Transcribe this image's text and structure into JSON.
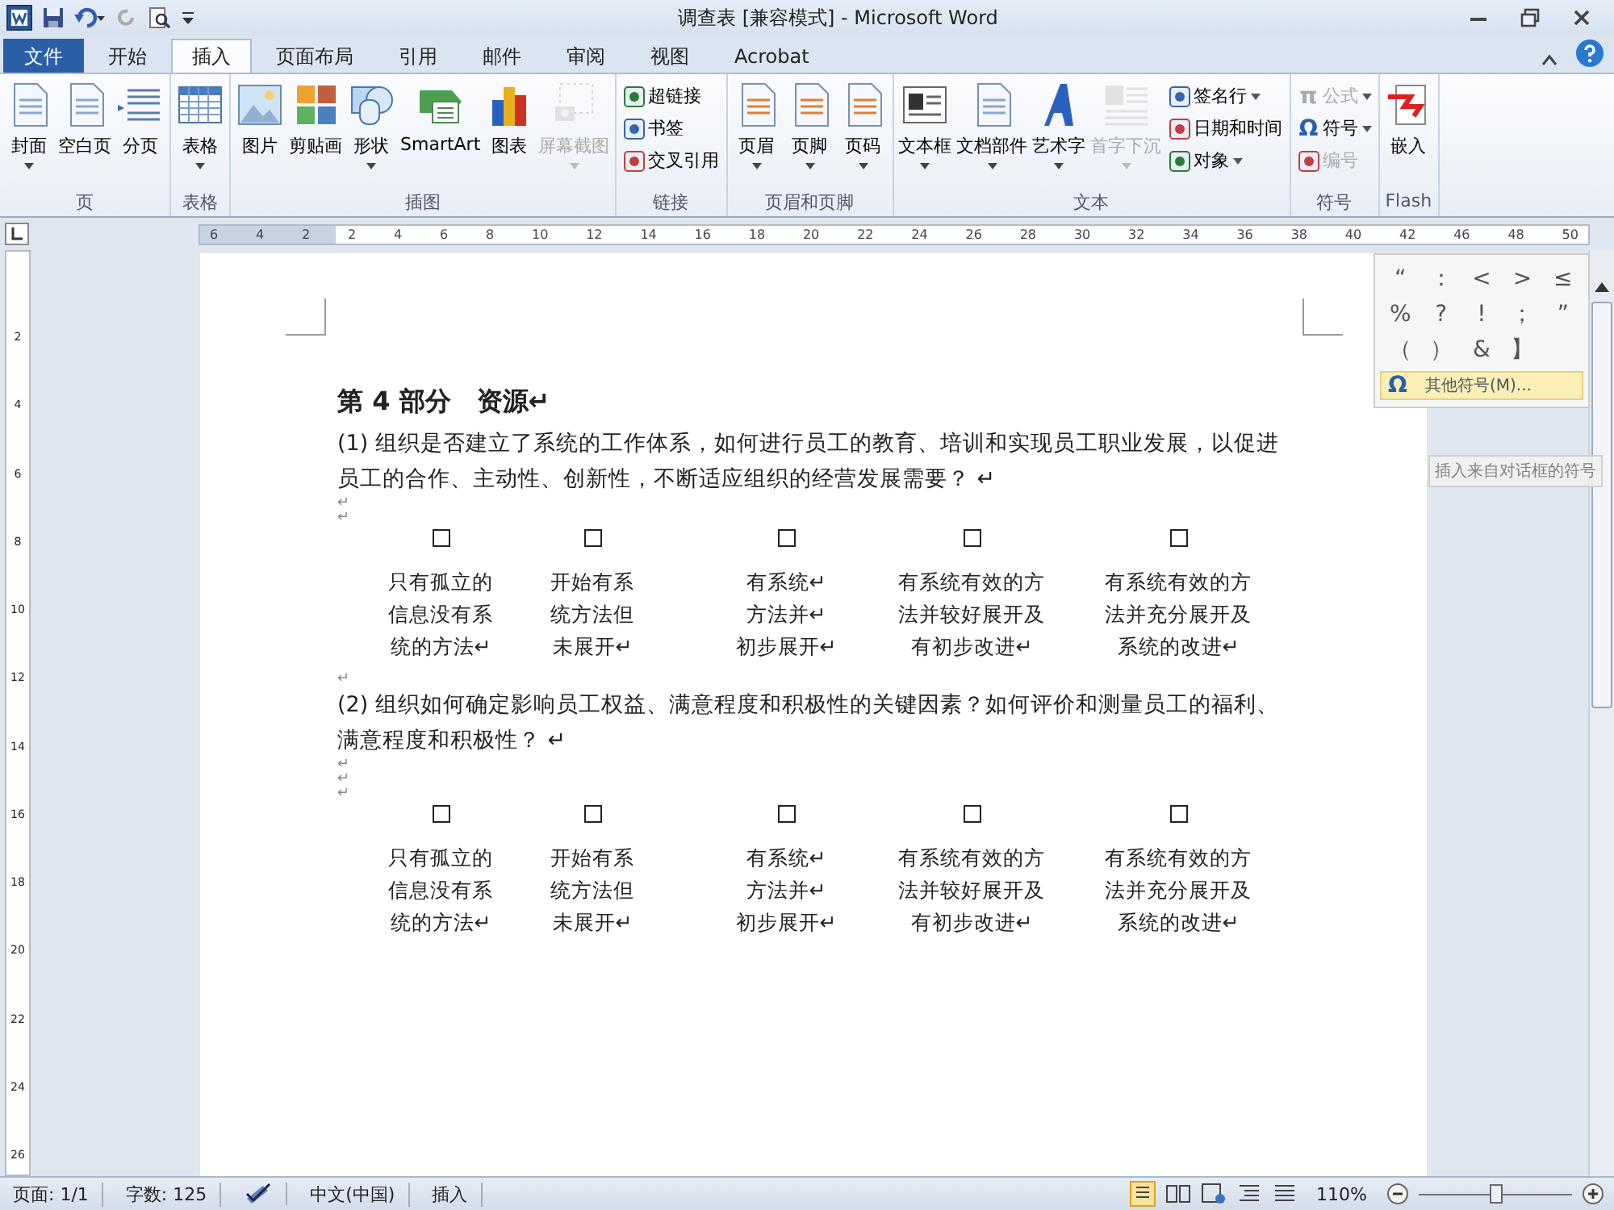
{
  "window": {
    "title": "调查表 [兼容模式] - Microsoft Word"
  },
  "tabs": [
    {
      "label": "文件",
      "kind": "file",
      "selected": false
    },
    {
      "label": "开始",
      "kind": "normal",
      "selected": false
    },
    {
      "label": "插入",
      "kind": "normal",
      "selected": true
    },
    {
      "label": "页面布局",
      "kind": "normal",
      "selected": false
    },
    {
      "label": "引用",
      "kind": "normal",
      "selected": false
    },
    {
      "label": "邮件",
      "kind": "normal",
      "selected": false
    },
    {
      "label": "审阅",
      "kind": "normal",
      "selected": false
    },
    {
      "label": "视图",
      "kind": "normal",
      "selected": false
    },
    {
      "label": "Acrobat",
      "kind": "normal",
      "selected": false
    }
  ],
  "ribbon": {
    "groups": [
      {
        "label": "页",
        "items": [
          {
            "kind": "large",
            "label": "封面",
            "dropdown": true,
            "disabled": false
          },
          {
            "kind": "large",
            "label": "空白页",
            "dropdown": false,
            "disabled": false
          },
          {
            "kind": "large",
            "label": "分页",
            "dropdown": false,
            "disabled": false
          }
        ]
      },
      {
        "label": "表格",
        "items": [
          {
            "kind": "large",
            "label": "表格",
            "dropdown": true,
            "disabled": false
          }
        ]
      },
      {
        "label": "插图",
        "items": [
          {
            "kind": "large",
            "label": "图片",
            "dropdown": false,
            "disabled": false
          },
          {
            "kind": "large",
            "label": "剪贴画",
            "dropdown": false,
            "disabled": false
          },
          {
            "kind": "large",
            "label": "形状",
            "dropdown": true,
            "disabled": false
          },
          {
            "kind": "large",
            "label": "SmartArt",
            "dropdown": false,
            "disabled": false
          },
          {
            "kind": "large",
            "label": "图表",
            "dropdown": false,
            "disabled": false
          },
          {
            "kind": "large",
            "label": "屏幕截图",
            "dropdown": true,
            "disabled": true
          }
        ]
      },
      {
        "label": "链接",
        "items": [
          {
            "kind": "small",
            "label": "超链接",
            "dropdown": false,
            "disabled": false
          },
          {
            "kind": "small",
            "label": "书签",
            "dropdown": false,
            "disabled": false
          },
          {
            "kind": "small",
            "label": "交叉引用",
            "dropdown": false,
            "disabled": false
          }
        ]
      },
      {
        "label": "页眉和页脚",
        "items": [
          {
            "kind": "large",
            "label": "页眉",
            "dropdown": true,
            "disabled": false
          },
          {
            "kind": "large",
            "label": "页脚",
            "dropdown": true,
            "disabled": false
          },
          {
            "kind": "large",
            "label": "页码",
            "dropdown": true,
            "disabled": false
          }
        ]
      },
      {
        "label": "文本",
        "items": [
          {
            "kind": "large",
            "label": "文本框",
            "dropdown": true,
            "disabled": false
          },
          {
            "kind": "large",
            "label": "文档部件",
            "dropdown": true,
            "disabled": false
          },
          {
            "kind": "large",
            "label": "艺术字",
            "dropdown": true,
            "disabled": false
          },
          {
            "kind": "large",
            "label": "首字下沉",
            "dropdown": true,
            "disabled": true
          },
          {
            "kind": "small",
            "label": "签名行",
            "dropdown": true,
            "disabled": false
          },
          {
            "kind": "small",
            "label": "日期和时间",
            "dropdown": false,
            "disabled": false
          },
          {
            "kind": "small",
            "label": "对象",
            "dropdown": true,
            "disabled": false
          }
        ]
      },
      {
        "label": "符号",
        "items": [
          {
            "kind": "small",
            "label": "公式",
            "glyph": "π",
            "dropdown": true,
            "disabled": true
          },
          {
            "kind": "small",
            "label": "符号",
            "glyph": "Ω",
            "dropdown": true,
            "disabled": false
          },
          {
            "kind": "small",
            "label": "编号",
            "dropdown": false,
            "disabled": true
          }
        ]
      },
      {
        "label": "Flash",
        "items": [
          {
            "kind": "large",
            "label": "嵌入",
            "dropdown": false,
            "disabled": false
          }
        ]
      }
    ]
  },
  "symbol_menu": {
    "symbols": [
      "“",
      "：",
      "<",
      ">",
      "≤",
      "%",
      "?",
      "!",
      "；",
      "”",
      "（",
      "）",
      "&",
      "】"
    ],
    "more": {
      "glyph": "Ω",
      "label": "其他符号(M)..."
    },
    "tooltip": "插入来自对话框的符号"
  },
  "ruler": {
    "horizontal": [
      "6",
      "4",
      "2",
      "2",
      "4",
      "6",
      "8",
      "10",
      "12",
      "14",
      "16",
      "18",
      "20",
      "22",
      "24",
      "26",
      "28",
      "30",
      "32",
      "34",
      "36",
      "38",
      "40",
      "42",
      "46",
      "48",
      "50"
    ],
    "vertical": [
      "2",
      "4",
      "6",
      "8",
      "10",
      "12",
      "14",
      "16",
      "18",
      "20",
      "22",
      "24",
      "26"
    ]
  },
  "document": {
    "heading": "第 4 部分　资源↵",
    "questions": [
      {
        "text": "(1)  组织是否建立了系统的工作体系，如何进行员工的教育、培训和实现员工职业发展，以促进员工的合作、主动性、创新性，不断适应组织的经营发展需要？ ↵",
        "marks": [
          "↵",
          "↵"
        ],
        "options": [
          {
            "checked": false,
            "lines": [
              "只有孤立的",
              "信息没有系",
              "统的方法↵"
            ]
          },
          {
            "checked": false,
            "lines": [
              "开始有系",
              "统方法但",
              "未展开↵"
            ]
          },
          {
            "checked": false,
            "lines": [
              "有系统↵",
              "方法并↵",
              "初步展开↵"
            ]
          },
          {
            "checked": false,
            "lines": [
              "有系统有效的方",
              "法并较好展开及",
              "有初步改进↵"
            ]
          },
          {
            "checked": false,
            "lines": [
              "有系统有效的方",
              "法并充分展开及",
              "系统的改进↵"
            ]
          }
        ],
        "after_marks": [
          "↵"
        ]
      },
      {
        "text": "(2)  组织如何确定影响员工权益、满意程度和积极性的关键因素？如何评价和测量员工的福利、满意程度和积极性？ ↵",
        "marks": [
          "↵",
          "↵",
          "↵"
        ],
        "options": [
          {
            "checked": false,
            "lines": [
              "只有孤立的",
              "信息没有系",
              "统的方法↵"
            ]
          },
          {
            "checked": false,
            "lines": [
              "开始有系",
              "统方法但",
              "未展开↵"
            ]
          },
          {
            "checked": false,
            "lines": [
              "有系统↵",
              "方法并↵",
              "初步展开↵"
            ]
          },
          {
            "checked": false,
            "lines": [
              "有系统有效的方",
              "法并较好展开及",
              "有初步改进↵"
            ]
          },
          {
            "checked": false,
            "lines": [
              "有系统有效的方",
              "法并充分展开及",
              "系统的改进↵"
            ]
          }
        ]
      }
    ]
  },
  "status_bar": {
    "page": "页面: 1/1",
    "words": "字数: 125",
    "language": "中文(中国)",
    "mode": "插入",
    "zoom": "110%",
    "zoom_slider": {
      "level": 0.5
    }
  }
}
